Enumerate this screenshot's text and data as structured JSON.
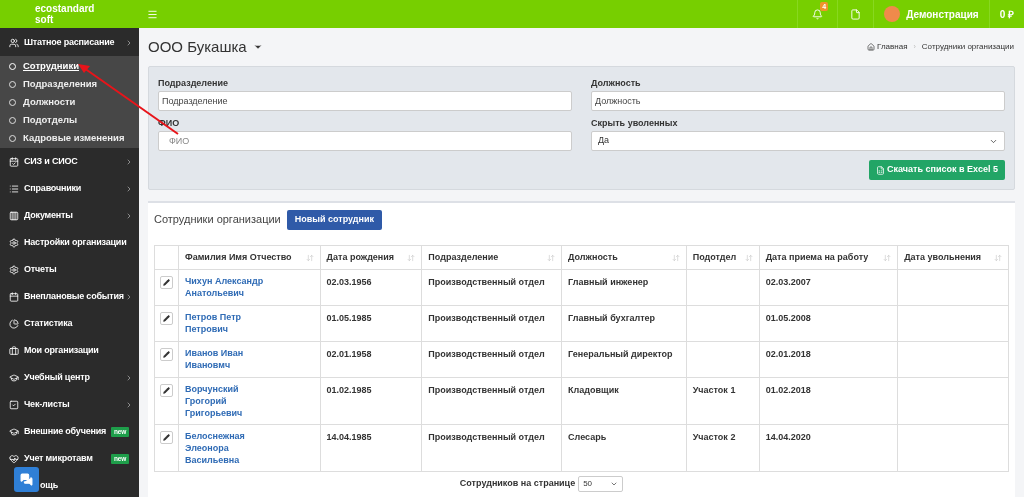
{
  "header": {
    "logo_lines": [
      "ecostandard",
      "soft"
    ],
    "notifications": "4",
    "user": "Демонстрация",
    "balance": "0 ₽"
  },
  "sidebar": {
    "items": [
      {
        "label": "Штатное расписание",
        "expandable": true,
        "expanded": true,
        "children": [
          {
            "label": "Сотрудники",
            "selected": true
          },
          {
            "label": "Подразделения",
            "selected": false
          },
          {
            "label": "Должности",
            "selected": false
          },
          {
            "label": "Подотделы",
            "selected": false
          },
          {
            "label": "Кадровые изменения",
            "selected": false
          }
        ]
      },
      {
        "label": "СИЗ и СИОС",
        "expandable": true,
        "expanded": false
      },
      {
        "label": "Справочники",
        "expandable": true,
        "expanded": false
      },
      {
        "label": "Документы",
        "expandable": true,
        "expanded": false
      },
      {
        "label": "Настройки организации",
        "expandable": false
      },
      {
        "label": "Отчеты",
        "expandable": false
      },
      {
        "label": "Внеплановые события",
        "expandable": true,
        "expanded": false
      },
      {
        "label": "Статистика",
        "expandable": false
      },
      {
        "label": "Мои организации",
        "expandable": false
      },
      {
        "label": "Учебный центр",
        "expandable": true,
        "expanded": false
      },
      {
        "label": "Чек-листы",
        "expandable": true,
        "expanded": false
      },
      {
        "label": "Внешние обучения",
        "expandable": false,
        "badge": "new"
      },
      {
        "label": "Учет микротавм",
        "expandable": false,
        "badge": "new"
      },
      {
        "label": "ощь",
        "expandable": false,
        "kind": "covered"
      }
    ]
  },
  "page": {
    "title": "ООО Букашка",
    "breadcrumbs": [
      "Главная",
      "Сотрудники организации"
    ],
    "breadcrumb_separator": "›"
  },
  "filters": {
    "fields": [
      {
        "label": "Подразделение",
        "kind": "text",
        "placeholder": "Подразделение"
      },
      {
        "label": "Должность",
        "kind": "text",
        "placeholder": "Должность"
      },
      {
        "label": "ФИО",
        "kind": "text",
        "placeholder": "ФИО"
      },
      {
        "label": "Скрыть уволенных",
        "kind": "select",
        "value": "Да"
      }
    ],
    "export_button": "Скачать список в Excel 5"
  },
  "table_card": {
    "title": "Сотрудники организации",
    "new_button": "Новый сотрудник",
    "columns": [
      "Фамилия Имя Отчество",
      "Дата рождения",
      "Подразделение",
      "Должность",
      "Подотдел",
      "Дата приема на работу",
      "Дата увольнения"
    ],
    "rows": [
      {
        "cells": [
          "Чихун Александр\nАнатольевич",
          "02.03.1956",
          "Производственный отдел",
          "Главный инженер",
          "",
          "02.03.2007",
          ""
        ]
      },
      {
        "cells": [
          "Петров Петр\nПетрович",
          "01.05.1985",
          "Производственный отдел",
          "Главный бухгалтер",
          "",
          "01.05.2008",
          ""
        ]
      },
      {
        "cells": [
          "Иванов Иван\nИвановмч",
          "02.01.1958",
          "Производственный отдел",
          "Генеральный директор",
          "",
          "02.01.2018",
          ""
        ]
      },
      {
        "cells": [
          "Ворчунский\nГрогорий\nГригорьевич",
          "01.02.1985",
          "Производственный отдел",
          "Кладовщик",
          "Участок 1",
          "01.02.2018",
          ""
        ]
      },
      {
        "cells": [
          "Белоснежная\nЭлеонора\nВасильевна",
          "14.04.1985",
          "Производственный отдел",
          "Слесарь",
          "Участок 2",
          "14.04.2020",
          ""
        ]
      }
    ],
    "page_size_label": "Сотрудников на странице",
    "page_size": "50"
  }
}
